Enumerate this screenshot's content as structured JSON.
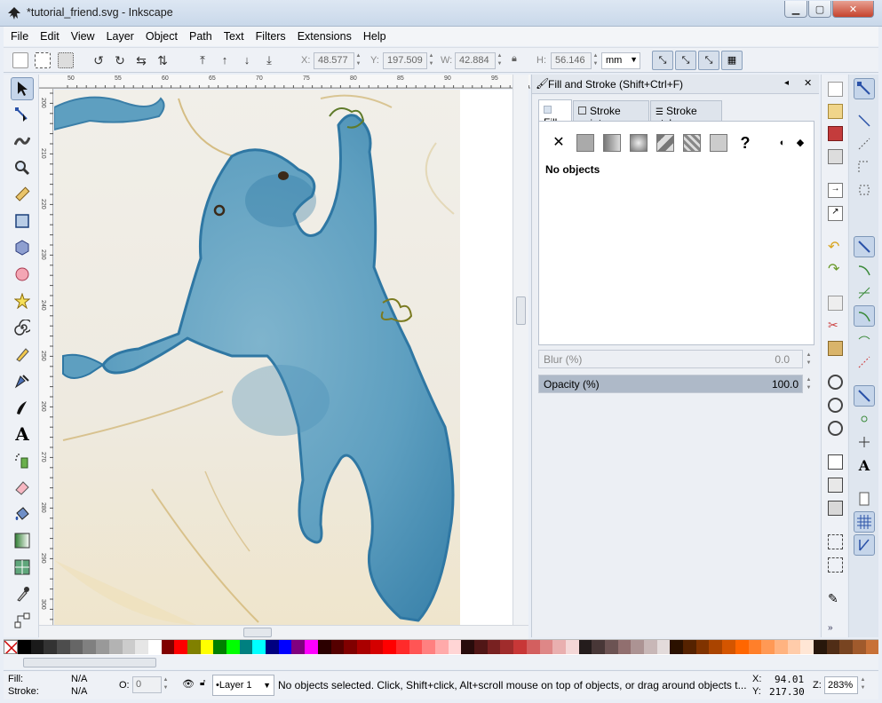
{
  "window": {
    "title": "*tutorial_friend.svg - Inkscape"
  },
  "menu": [
    "File",
    "Edit",
    "View",
    "Layer",
    "Object",
    "Path",
    "Text",
    "Filters",
    "Extensions",
    "Help"
  ],
  "toolbar": {
    "x_label": "X:",
    "x_value": "48.577",
    "y_label": "Y:",
    "y_value": "197.509",
    "w_label": "W:",
    "w_value": "42.884",
    "h_label": "H:",
    "h_value": "56.146",
    "unit": "mm"
  },
  "rulers": {
    "h_ticks": [
      "50",
      "55",
      "60",
      "65",
      "70",
      "75",
      "80",
      "85",
      "90",
      "95"
    ],
    "v_ticks": [
      "200",
      "210",
      "220",
      "230",
      "240",
      "250",
      "260",
      "270",
      "280",
      "290",
      "300"
    ]
  },
  "dock": {
    "title": "Fill and Stroke (Shift+Ctrl+F)",
    "tabs": [
      "Fill",
      "Stroke paint",
      "Stroke style"
    ],
    "message": "No objects",
    "blur_label": "Blur (%)",
    "blur_value": "0.0",
    "opacity_label": "Opacity (%)",
    "opacity_value": "100.0",
    "opacity_fraction": 1.0
  },
  "palette": [
    "#000000",
    "#1a1a1a",
    "#333333",
    "#4d4d4d",
    "#666666",
    "#808080",
    "#999999",
    "#b3b3b3",
    "#cccccc",
    "#e6e6e6",
    "#ffffff",
    "#800000",
    "#ff0000",
    "#808000",
    "#ffff00",
    "#008000",
    "#00ff00",
    "#008080",
    "#00ffff",
    "#000080",
    "#0000ff",
    "#800080",
    "#ff00ff",
    "#2b0000",
    "#550000",
    "#800000",
    "#aa0000",
    "#d40000",
    "#ff0000",
    "#ff2a2a",
    "#ff5555",
    "#ff8080",
    "#ffaaaa",
    "#ffd5d5",
    "#280b0b",
    "#501616",
    "#782121",
    "#a02c2c",
    "#c83737",
    "#d35f5f",
    "#de8787",
    "#e9afaf",
    "#f4d7d7",
    "#241c1c",
    "#483737",
    "#6c5353",
    "#916f6f",
    "#ac9393",
    "#c8b7b7",
    "#e3dbdb",
    "#2b1100",
    "#552200",
    "#803300",
    "#aa4400",
    "#d45500",
    "#ff6600",
    "#ff7f2a",
    "#ff9955",
    "#ffb380",
    "#ffccaa",
    "#ffe6d5",
    "#28170b",
    "#502d16",
    "#784421",
    "#a05a2c",
    "#c87137"
  ],
  "status": {
    "fill_label": "Fill:",
    "fill_value": "N/A",
    "stroke_label": "Stroke:",
    "stroke_value": "N/A",
    "opacity_label": "O:",
    "opacity_value": "0",
    "layer": "•Layer 1",
    "message": "No objects selected. Click, Shift+click, Alt+scroll mouse on top of objects, or drag around objects t...",
    "x_label": "X:",
    "x_value": "94.01",
    "y_label": "Y:",
    "y_value": "217.30",
    "z_label": "Z:",
    "zoom": "283%"
  }
}
